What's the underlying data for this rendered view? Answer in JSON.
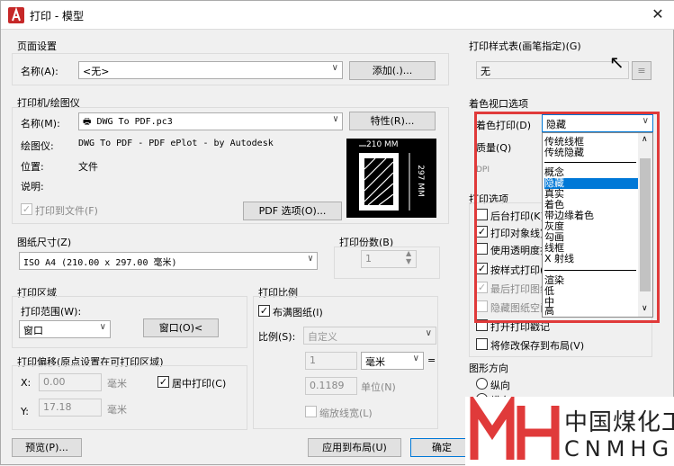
{
  "window": {
    "title": "打印 - 模型",
    "close_glyph": "✕"
  },
  "page_setup": {
    "group": "页面设置",
    "name_label": "名称(A):",
    "name_value": "<无>",
    "add_button": "添加(.)..."
  },
  "printer": {
    "group": "打印机/绘图仪",
    "name_label": "名称(M):",
    "name_value": "DWG To PDF.pc3",
    "properties_button": "特性(R)...",
    "plotter_label": "绘图仪:",
    "plotter_value": "DWG To PDF - PDF ePlot - by Autodesk",
    "location_label": "位置:",
    "location_value": "文件",
    "description_label": "说明:",
    "print_to_file": "打印到文件(F)",
    "pdf_options_button": "PDF 选项(O)...",
    "paper_width": "210 MM",
    "paper_height": "297 MM"
  },
  "paper_size": {
    "group": "图纸尺寸(Z)",
    "value": "ISO A4 (210.00 x 297.00 毫米)"
  },
  "copies": {
    "label": "打印份数(B)",
    "value": "1"
  },
  "plot_area": {
    "group": "打印区域",
    "range_label": "打印范围(W):",
    "range_value": "窗口",
    "window_button": "窗口(O)<"
  },
  "plot_offset": {
    "group": "打印偏移(原点设置在可打印区域)",
    "x_label": "X:",
    "x_value": "0.00",
    "y_label": "Y:",
    "y_value": "17.18",
    "unit": "毫米",
    "center": "居中打印(C)"
  },
  "plot_scale": {
    "group": "打印比例",
    "fit": "布满图纸(I)",
    "scale_label": "比例(S):",
    "scale_value": "自定义",
    "val1": "1",
    "unit1": "毫米",
    "eq": "=",
    "val2": "0.1189",
    "unit2": "单位(N)",
    "lineweights": "缩放线宽(L)"
  },
  "plot_style": {
    "group": "打印样式表(画笔指定)(G)",
    "value": "无"
  },
  "shaded": {
    "group": "着色视口选项",
    "shade_label": "着色打印(D)",
    "shade_value": "隐藏",
    "quality_label": "质量(Q)",
    "dpi_label": "DPI",
    "options": [
      "传统线框",
      "传统隐藏",
      "概念",
      "隐藏",
      "真实",
      "着色",
      "带边缘着色",
      "灰度",
      "勾画",
      "线框",
      "X 射线",
      "渲染",
      "低",
      "中",
      "高"
    ]
  },
  "plot_options": {
    "group": "打印选项",
    "items": [
      "后台打印(K)",
      "打印对象线宽",
      "使用透明度打印(T)",
      "按样式打印(E)",
      "最后打印图纸空间",
      "隐藏图纸空间对象(J)",
      "打开打印戳记",
      "将修改保存到布局(V)"
    ]
  },
  "orientation": {
    "group": "图形方向",
    "portrait": "纵向",
    "landscape": "横向"
  },
  "footer": {
    "preview": "预览(P)...",
    "apply": "应用到布局(U)",
    "ok": "确定"
  },
  "watermark": {
    "text_cn": "中国煤化工",
    "text_en": "CNMHG",
    "logo": "MH"
  },
  "colors": {
    "accent": "#0078d7",
    "highlight_border": "#e03a3a",
    "logo_red": "#e03a3a"
  }
}
